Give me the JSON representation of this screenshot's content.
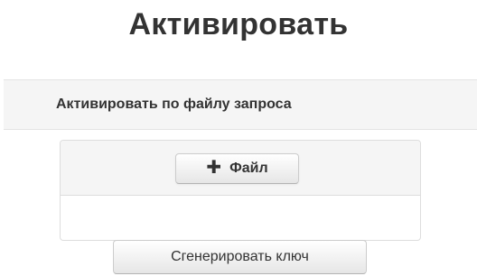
{
  "header": {
    "title": "Активировать"
  },
  "section": {
    "title": "Активировать по файлу запроса"
  },
  "upload": {
    "file_button_icon": "plus-icon",
    "file_button_label": "Файл",
    "file_list": ""
  },
  "actions": {
    "generate_label": "Сгенерировать ключ"
  },
  "colors": {
    "panel_background": "#f5f5f5",
    "border": "#dddddd",
    "text": "#333333"
  }
}
